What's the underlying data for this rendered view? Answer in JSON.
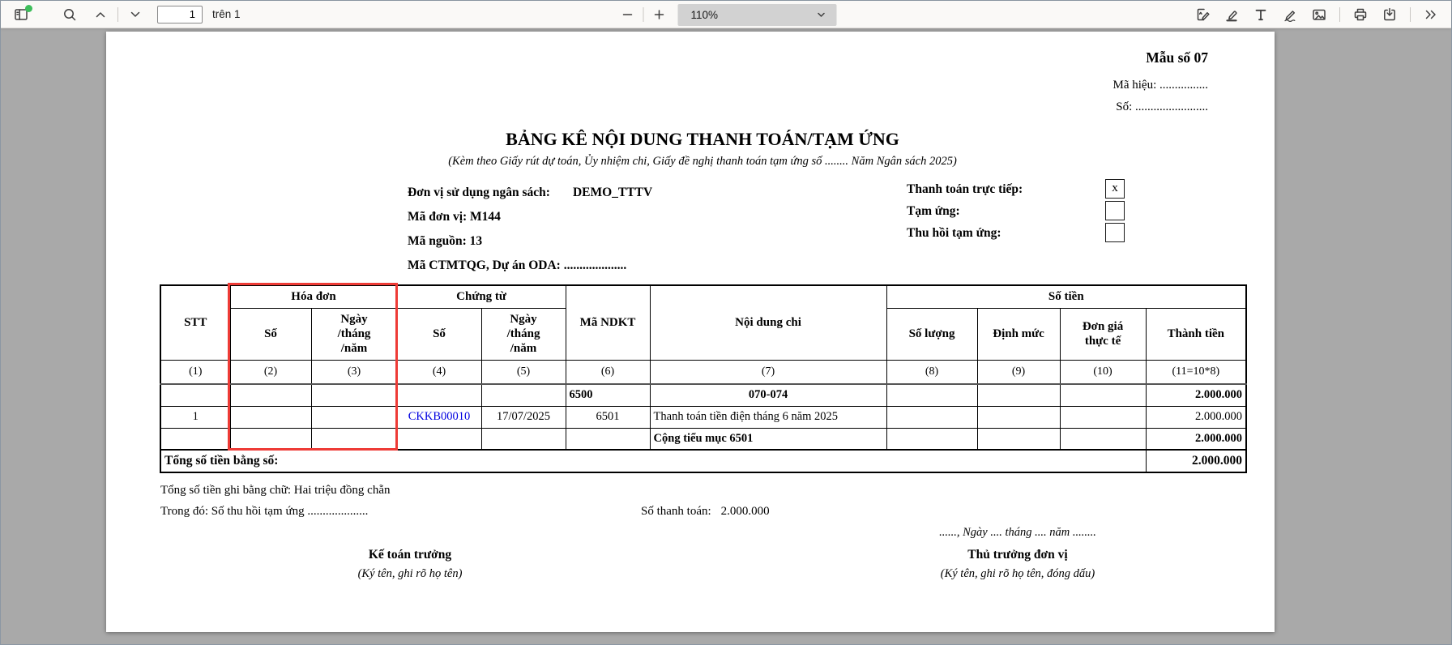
{
  "toolbar": {
    "page_input": "1",
    "page_total": "trên 1",
    "zoom_level": "110%"
  },
  "document": {
    "form_no": "Mẫu số 07",
    "ma_hieu": "Mã hiệu: ................",
    "so_line": "Số: ........................",
    "title": "BẢNG KÊ NỘI DUNG THANH TOÁN/TẠM ỨNG",
    "subtitle": "(Kèm theo Giấy rút dự toán, Ủy nhiệm chi, Giấy đề nghị thanh toán tạm ứng số ........ Năm Ngân sách 2025)",
    "info": {
      "unit_label": "Đơn vị sử dụng ngân sách:",
      "unit_value": "DEMO_TTTV",
      "unit_code": "Mã đơn vị: M144",
      "source_code": "Mã nguồn: 13",
      "program_code": "Mã CTMTQG, Dự án ODA: ...................."
    },
    "checkboxes": [
      {
        "label": "Thanh toán trực tiếp:",
        "value": "x"
      },
      {
        "label": "Tạm ứng:",
        "value": ""
      },
      {
        "label": "Thu hồi tạm ứng:",
        "value": ""
      }
    ]
  },
  "table": {
    "headers": {
      "stt": "STT",
      "invoice_group": "Hóa đơn",
      "voucher_group": "Chứng từ",
      "amount_group": "Số tiền",
      "number": "Số",
      "date": "Ngày\n/tháng\n/năm",
      "ndkt": "Mã NDKT",
      "content": "Nội dung chi",
      "quantity": "Số lượng",
      "norm": "Định mức",
      "unit_price": "Đơn giá\nthực tế",
      "total": "Thành tiền"
    },
    "numbering": [
      "(1)",
      "(2)",
      "(3)",
      "(4)",
      "(5)",
      "(6)",
      "(7)",
      "(8)",
      "(9)",
      "(10)",
      "(11=10*8)"
    ],
    "rows": [
      {
        "ndkt": "6500",
        "content": "070-074",
        "amount": "2.000.000"
      },
      {
        "stt": "1",
        "voucher_no": "CKKB00010",
        "voucher_date": "17/07/2025",
        "ndkt": "6501",
        "content": "Thanh toán tiền điện tháng 6 năm 2025",
        "amount": "2.000.000"
      },
      {
        "content": "Cộng tiểu mục 6501",
        "amount": "2.000.000"
      }
    ],
    "total_label": "Tổng số tiền bằng số:",
    "total_amount": "2.000.000"
  },
  "footer": {
    "amount_in_words": "Tổng số tiền ghi bằng chữ: Hai triệu đồng chẵn",
    "breakdown": "Trong đó: Số thu hồi tạm ứng ....................",
    "payment_label": "Số thanh toán:",
    "payment_amount": "2.000.000",
    "date_line": "......, Ngày .... tháng .... năm ........",
    "sign_left_title": "Kế toán trưởng",
    "sign_left_sub": "(Ký tên, ghi rõ họ tên)",
    "sign_right_title": "Thủ trưởng đơn vị",
    "sign_right_sub": "(Ký tên, ghi rõ họ tên, đóng dấu)"
  }
}
